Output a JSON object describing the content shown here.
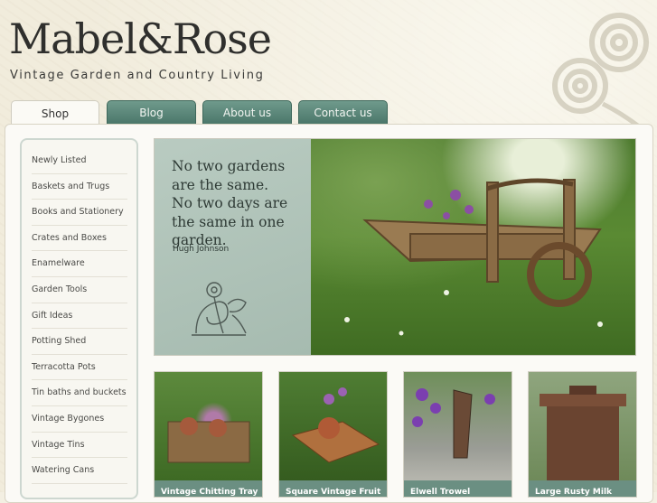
{
  "brand": {
    "logo": "Mabel&Rose",
    "tagline": "Vintage Garden and Country Living"
  },
  "nav": {
    "tabs": [
      {
        "label": "Shop"
      },
      {
        "label": "Blog"
      },
      {
        "label": "About us"
      },
      {
        "label": "Contact us"
      }
    ]
  },
  "sidebar": {
    "items": [
      {
        "label": "Newly Listed"
      },
      {
        "label": "Baskets and Trugs"
      },
      {
        "label": "Books and Stationery"
      },
      {
        "label": "Crates and Boxes"
      },
      {
        "label": "Enamelware"
      },
      {
        "label": "Garden Tools"
      },
      {
        "label": "Gift Ideas"
      },
      {
        "label": "Potting Shed"
      },
      {
        "label": "Terracotta Pots"
      },
      {
        "label": "Tin baths and buckets"
      },
      {
        "label": "Vintage Bygones"
      },
      {
        "label": "Vintage Tins"
      },
      {
        "label": "Watering Cans"
      }
    ]
  },
  "hero": {
    "quote_lines": [
      "No two gardens",
      "are the same.",
      "No two days are",
      "the same in one",
      "garden."
    ],
    "author": "Hugh Johnson",
    "photo_icon": "wheelbarrow-photo"
  },
  "products": [
    {
      "caption": "Vintage Chitting Tray"
    },
    {
      "caption": "Square Vintage Fruit"
    },
    {
      "caption": "Elwell Trowel"
    },
    {
      "caption": "Large Rusty Milk"
    }
  ],
  "colors": {
    "tab_green": "#5c8677",
    "caption_green": "#6b8f82",
    "quote_panel": "#b3c6bb",
    "page_bg": "#f1ecdc"
  }
}
